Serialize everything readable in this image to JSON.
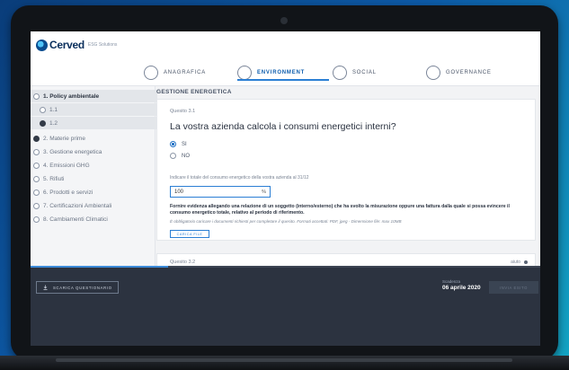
{
  "brand": {
    "name": "Cerved",
    "sub": "ESG Solutions"
  },
  "steps": [
    {
      "label": "ANAGRAFICA"
    },
    {
      "label": "ENVIRONMENT"
    },
    {
      "label": "SOCIAL"
    },
    {
      "label": "GOVERNANCE"
    }
  ],
  "sidebar": {
    "items": [
      {
        "label": "1. Policy ambientale"
      },
      {
        "label": "1.1"
      },
      {
        "label": "1.2"
      },
      {
        "label": "2. Materie prime"
      },
      {
        "label": "3. Gestione energetica"
      },
      {
        "label": "4. Emissioni GHG"
      },
      {
        "label": "5. Rifiuti"
      },
      {
        "label": "6. Prodotti e servizi"
      },
      {
        "label": "7. Certificazioni Ambientali"
      },
      {
        "label": "8. Cambiamenti Climatici"
      }
    ]
  },
  "main": {
    "section_title": "GESTIONE ENERGETICA",
    "question1": {
      "number": "Quesito 3.1",
      "title": "La vostra azienda calcola i consumi energetici interni?",
      "options": [
        {
          "label": "SI",
          "selected": true
        },
        {
          "label": "NO",
          "selected": false
        }
      ],
      "field_label": "Indicare il totale del consumo energetico della vostra azienda al 31/12",
      "field_value": "100",
      "field_unit": "%",
      "description": "Fornire evidenza allegando una relazione di un soggetto (interno/esterno) che ha svolto la misurazione oppure una fattura dalla quale si possa evincere il consumo energetico totale, relativo al periodo di riferimento.",
      "note": "È obbligatorio caricare i documenti richiesti per completare il quesito. Formati accettati: PDF, jpeg - Dimensione file: max 10MB",
      "upload_label": "CARICA FILE"
    },
    "question2": {
      "number": "Quesito 3.2",
      "state": "aiuto"
    }
  },
  "footer": {
    "progress": 0.27,
    "download_label": "SCARICA QUESTIONARIO",
    "deadline_label": "Scadenza",
    "deadline_value": "06 aprile 2020",
    "send_label": "INVIA ESITO"
  },
  "colors": {
    "accent": "#2b7fd4",
    "footer_bg": "#2c3340"
  }
}
